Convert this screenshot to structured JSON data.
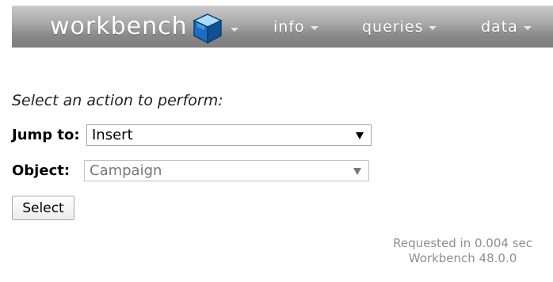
{
  "header": {
    "logo_text": "workbench",
    "menu": [
      {
        "label": "info"
      },
      {
        "label": "queries"
      },
      {
        "label": "data"
      }
    ]
  },
  "main": {
    "prompt": "Select an action to perform:",
    "jump_to": {
      "label": "Jump to:",
      "value": "Insert"
    },
    "object": {
      "label": "Object:",
      "value": "Campaign"
    },
    "select_button": "Select"
  },
  "footer": {
    "requested": "Requested in 0.004 sec",
    "version": "Workbench 48.0.0"
  },
  "colors": {
    "navbar": "#8a8a8a",
    "menu_text": "#ffffff",
    "footer_text": "#8f8f8f",
    "cube_blue": "#1a6fc0"
  }
}
